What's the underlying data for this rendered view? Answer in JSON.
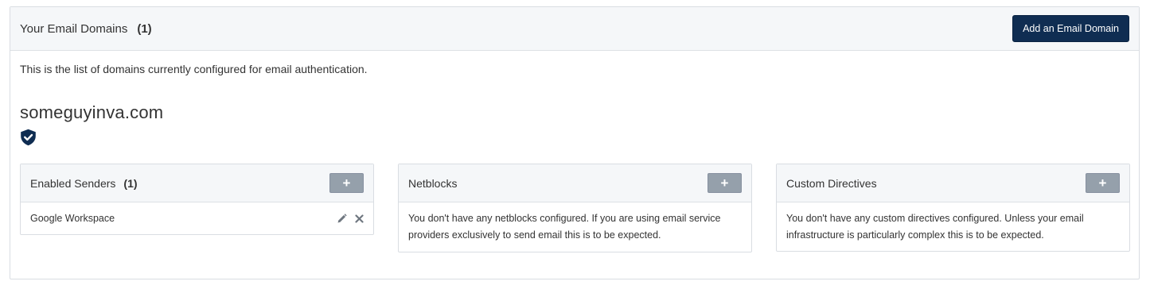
{
  "header": {
    "title": "Your Email Domains",
    "count": "(1)",
    "add_button": "Add an Email Domain"
  },
  "intro_text": "This is the list of domains currently configured for email authentication.",
  "domain": {
    "name": "someguyinva.com",
    "status_icon": "shield-check-icon"
  },
  "cards": {
    "senders": {
      "title": "Enabled Senders",
      "count": "(1)",
      "add_label": "+",
      "items": [
        {
          "name": "Google Workspace",
          "actions": [
            "pencil-icon",
            "close-icon"
          ]
        }
      ]
    },
    "netblocks": {
      "title": "Netblocks",
      "add_label": "+",
      "empty_text": "You don't have any netblocks configured. If you are using email service providers exclusively to send email this is to be expected."
    },
    "directives": {
      "title": "Custom Directives",
      "add_label": "+",
      "empty_text": "You don't have any custom directives configured. Unless your email infrastructure is particularly complex this is to be expected."
    }
  },
  "colors": {
    "primary_button": "#0f2d52",
    "add_button": "#95a0ab",
    "shield": "#0f2d52",
    "header_bg": "#f5f7f9"
  }
}
